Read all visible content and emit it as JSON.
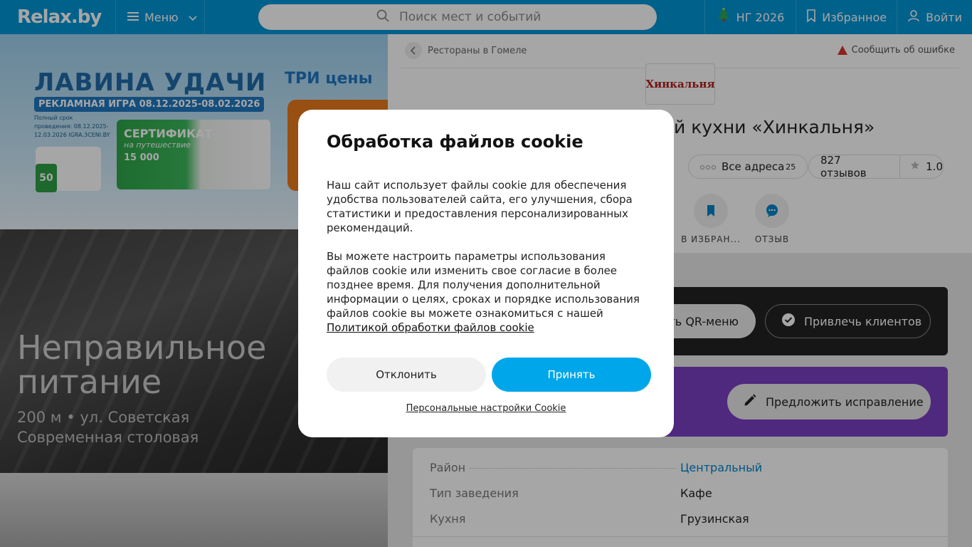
{
  "header": {
    "logo": "Relax.by",
    "menu_label": "Меню",
    "search_placeholder": "Поиск мест и событий",
    "ny_label": "НГ 2026",
    "favorites_label": "Избранное",
    "login_label": "Войти"
  },
  "banner": {
    "title": "ЛАВИНА УДАЧИ",
    "subtitle": "РЕКЛАМНАЯ ИГРА 08.12.2025-08.02.2026",
    "small_text": "Полный срок проведения: 08.12.2025-12.03.2026 IGRA.3CENI.BY",
    "brand": "ТРИ цены",
    "cert_title": "СЕРТИФИКАТ",
    "cert_sub": "на путешествие",
    "cert_value": "15 000",
    "card_value": "50"
  },
  "promo": {
    "title_line1": "Неправильное",
    "title_line2": "питание",
    "distance_street": "200 м • ул. Советская",
    "type": "Современная столовая"
  },
  "place": {
    "breadcrumb": "Рестораны в Гомеле",
    "report": "Сообщить об ошибке",
    "logo_text": "Хинкальня",
    "title": "й кухни «Хинкальня»",
    "all_addresses": "Все адреса",
    "addresses_count": "25",
    "reviews": "827 отзывов",
    "rating": "1.0",
    "action_favorites": "В ИЗБРАН...",
    "action_review": "ОТЗЫВ",
    "qr_menu": "ть QR-меню",
    "attract_clients": "Привлечь клиентов",
    "suggest_fix": "Предложить исправление",
    "info": [
      {
        "key": "Район",
        "value": "Центральный"
      },
      {
        "key": "Тип заведения",
        "value": "Кафе"
      },
      {
        "key": "Кухня",
        "value": "Грузинская"
      }
    ]
  },
  "cookie_modal": {
    "title": "Обработка файлов cookie",
    "paragraph1": "Наш сайт использует файлы cookie для обеспечения удобства пользователей сайта, его улучшения, сбора статистики и предоставления персонализированных рекомендаций.",
    "paragraph2": "Вы можете настроить параметры использования файлов cookie или изменить свое согласие в более позднее время. Для получения дополнительной информации о целях, сроках и порядке использования файлов cookie вы можете ознакомиться с нашей",
    "policy_link": "Политикой обработки файлов cookie",
    "decline": "Отклонить",
    "accept": "Принять",
    "settings_link": "Персональные настройки Cookie"
  },
  "colors": {
    "header_bg": "#0095d6",
    "accept_bg": "#00a6ea",
    "purple_panel": "#7a3fc0",
    "dark_panel": "#222222",
    "link": "#0083c8"
  }
}
